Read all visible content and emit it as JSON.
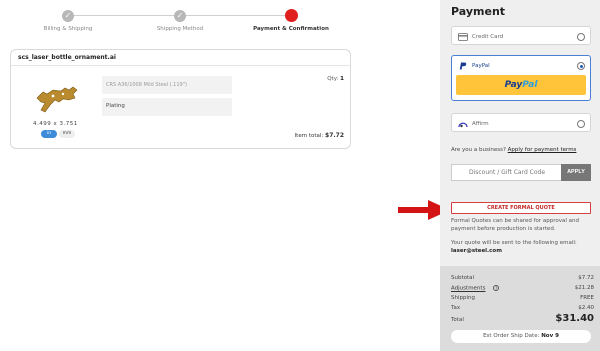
{
  "stepper": {
    "steps": [
      {
        "label": "Billing & Shipping",
        "state": "done"
      },
      {
        "label": "Shipping Method",
        "state": "done"
      },
      {
        "label": "Payment & Confirmation",
        "state": "active"
      }
    ],
    "check_glyph": "✓"
  },
  "cart": {
    "filename": "scs_laser_bottle_ornament.ai",
    "dim_w": "4.499",
    "dim_x": "x",
    "dim_h": "3.751",
    "units": [
      "in",
      "mm"
    ],
    "material": "CRS A36/1008 Mild Steel (.119\")",
    "finish": "Plating",
    "qty_label": "Qty:",
    "qty_value": "1",
    "item_total_label": "Item total:",
    "item_total_value": "$7.72"
  },
  "payment": {
    "title": "Payment",
    "options": [
      {
        "label": "Credit Card",
        "icon": "credit-card-icon",
        "selected": false
      },
      {
        "label": "PayPal",
        "icon": "paypal-icon",
        "selected": true
      },
      {
        "label": "Affirm",
        "icon": "affirm-icon",
        "selected": false
      }
    ],
    "paypal_button_a": "Pay",
    "paypal_button_b": "Pal",
    "business_text": "Are you a business?",
    "business_link": "Apply for payment terms",
    "discount_placeholder": "Discount / Gift Card Code",
    "apply_label": "APPLY",
    "quote_button": "CREATE FORMAL QUOTE",
    "quote_text": "Formal Quotes can be shared for approval and payment before production is started.",
    "quote_email_label": "Your quote will be sent to the following email:",
    "quote_email": "laser@steel.com"
  },
  "summary": {
    "rows": [
      {
        "label": "Subtotal",
        "value": "$7.72"
      },
      {
        "label": "Adjustments",
        "value": "$21.28"
      },
      {
        "label": "Shipping",
        "value": "FREE"
      },
      {
        "label": "Tax",
        "value": "$2.40"
      },
      {
        "label": "Total",
        "value": "$31.40"
      }
    ],
    "info_glyph": "?",
    "ship_date_label": "Est Order Ship Date:",
    "ship_date_value": "Nov 9"
  },
  "colors": {
    "accent_red": "#e01e1e",
    "paypal_yellow": "#ffc439",
    "unit_blue": "#3d8bd9"
  }
}
